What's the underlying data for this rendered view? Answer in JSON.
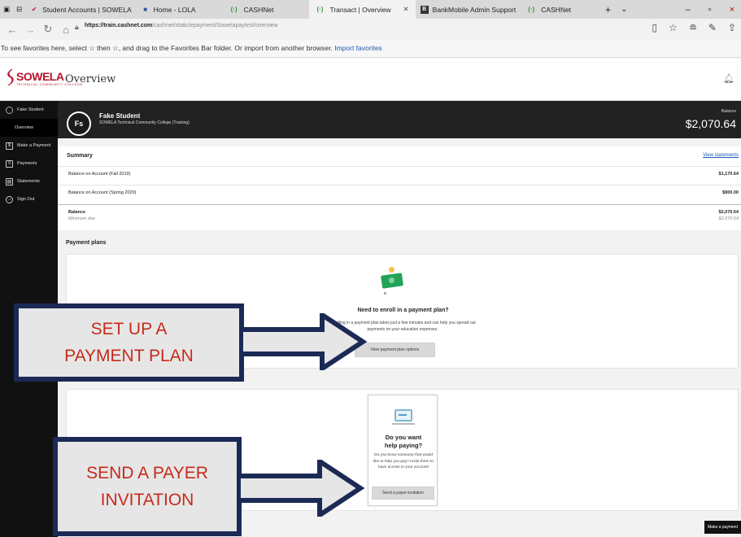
{
  "browser": {
    "tabs": [
      {
        "label": "Student Accounts | SOWELA",
        "fav": "✔"
      },
      {
        "label": "Home - LOLA",
        "fav": "■"
      },
      {
        "label": "CASHNet",
        "fav": "(·)"
      },
      {
        "label": "Transact | Overview",
        "fav": "(·)",
        "active": true
      },
      {
        "label": "BankMobile Admin Support",
        "fav": "B"
      },
      {
        "label": "CASHNet",
        "fav": "(·)"
      }
    ],
    "close_tab": "✕",
    "new_tab": "+",
    "tab_menu": "⌄",
    "url_host": "https://train.cashnet.com",
    "url_path": "/cashnet/static/epayment/Sowelapaytest/overview",
    "favorites_text": "To see favorites here, select ☆ then ☆, and drag to the Favorites Bar folder. Or import from another browser.",
    "favorites_link": "Import favorites"
  },
  "header": {
    "logo_text": "SOWELA",
    "logo_sub": "TECHNICAL COMMUNITY COLLEGE",
    "title": "Overview"
  },
  "sidebar": {
    "items": [
      {
        "label": "Fake Student",
        "icon": "user-icon"
      },
      {
        "label": "Overview",
        "icon": "",
        "active": true
      },
      {
        "label": "Make a Payment",
        "icon": "payment-icon"
      },
      {
        "label": "Payments",
        "icon": "list-icon"
      },
      {
        "label": "Statements",
        "icon": "document-icon"
      },
      {
        "label": "Sign Out",
        "icon": "sign-out-icon"
      }
    ]
  },
  "student": {
    "initials": "Fs",
    "name": "Fake Student",
    "school": "SOWELA Technical Community College (Training)",
    "balance_label": "Balance",
    "balance_value": "$2,070.64"
  },
  "summary": {
    "title": "Summary",
    "view_statements": "View statements",
    "rows": [
      {
        "label": "Balance on Account (Fall 2019)",
        "value": "$1,170.64"
      },
      {
        "label": "Balance on Account (Spring 2020)",
        "value": "$900.00"
      },
      {
        "label": "Balance",
        "value": "$2,070.64",
        "sub_label": "Minimum due",
        "sub_value": "$2,070.64"
      }
    ]
  },
  "payment_plans": {
    "section_title": "Payment plans",
    "heading": "Need to enroll in a payment plan?",
    "text": "Enrolling in a payment plan takes just a few minutes and can help you spread out payments on your education expenses.",
    "button": "View payment plan options"
  },
  "payer": {
    "heading": "Do you want help paying?",
    "text": "Do you know someone that would like to help you pay? Invite them to have access to your account!",
    "button": "Send a payer invitation"
  },
  "make_payment_button": "Make a payment",
  "callouts": {
    "setup": "SET UP A PAYMENT PLAN",
    "invite": "SEND A PAYER INVITATION",
    "border_color": "#1b2a55",
    "text_color": "#c72a1c"
  }
}
